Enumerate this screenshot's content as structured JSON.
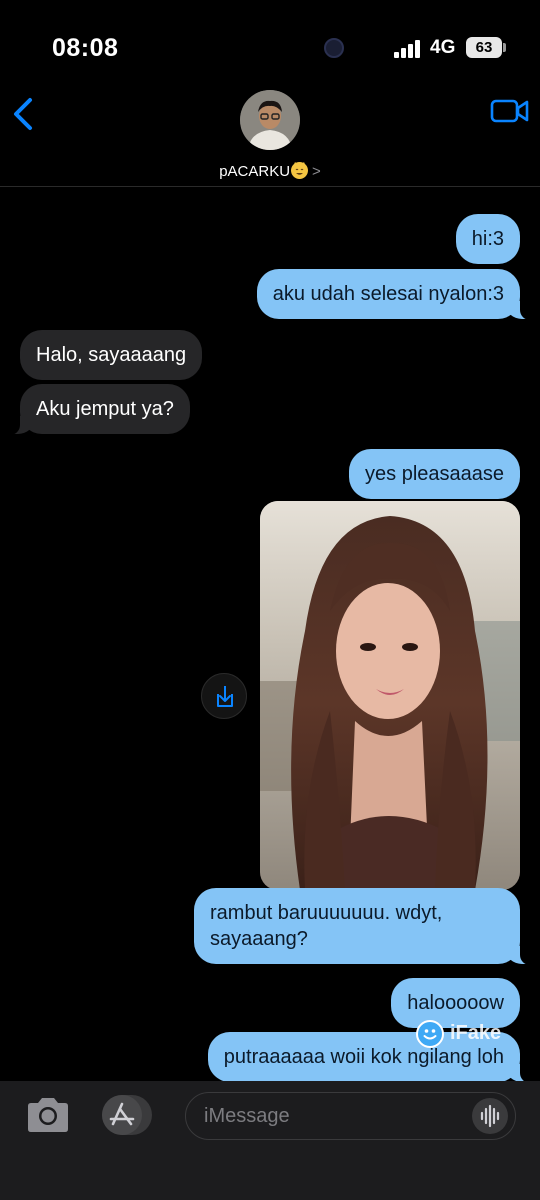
{
  "status_bar": {
    "time": "08:08",
    "network": "4G",
    "battery": "63"
  },
  "header": {
    "contact_name": "pACARKU",
    "contact_emoji": "smiling-cat-emoji",
    "chevron": ">"
  },
  "messages": [
    {
      "from": "me",
      "text": "hi:3"
    },
    {
      "from": "me",
      "text": "aku udah selesai nyalon:3"
    },
    {
      "from": "them",
      "text": "Halo, sayaaaang"
    },
    {
      "from": "them",
      "text": "Aku jemput ya?"
    },
    {
      "from": "me",
      "text": "yes pleasaaase"
    },
    {
      "from": "me",
      "type": "photo",
      "text": ""
    },
    {
      "from": "me",
      "text": "rambut baruuuuuuu. wdyt,\nsayaaang?"
    },
    {
      "from": "me",
      "text": "halooooow"
    },
    {
      "from": "me",
      "text": "putraaaaaa woii kok ngilang loh"
    }
  ],
  "watermark": {
    "text": "iFake"
  },
  "input": {
    "placeholder": "iMessage"
  },
  "icons": {
    "back": "chevron-left-icon",
    "video": "video-camera-icon",
    "save": "share-download-icon",
    "camera": "camera-icon",
    "apps": "app-store-icon",
    "audio": "waveform-icon"
  },
  "colors": {
    "accent": "#0a84ff",
    "sent_bubble": "#84c4f6",
    "received_bubble": "#262628",
    "background": "#000000"
  }
}
